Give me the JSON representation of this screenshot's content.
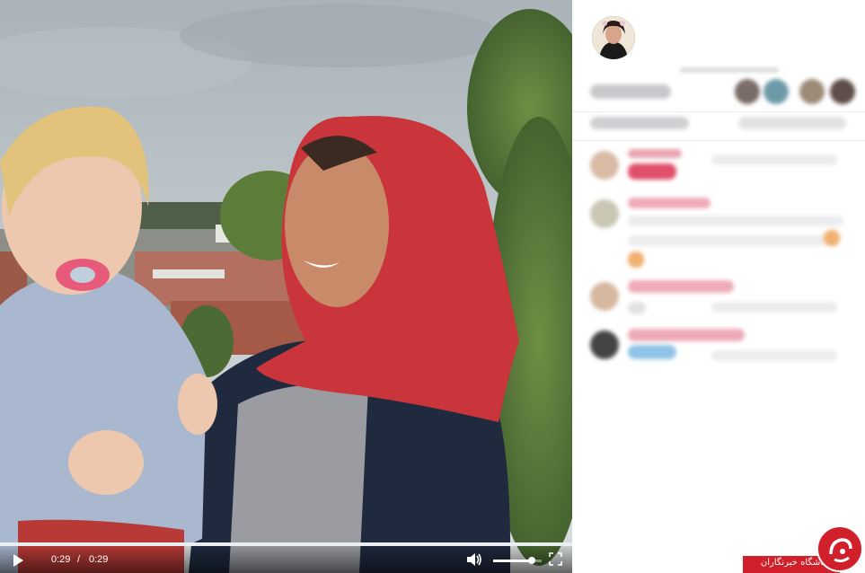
{
  "player": {
    "current_time": "0:29",
    "separator": "/",
    "duration": "0:29",
    "progress": 1.0,
    "volume": 0.8,
    "icons": {
      "play": "play-icon",
      "volume": "volume-icon",
      "fullscreen": "fullscreen-icon"
    }
  },
  "watermark": {
    "text": "باشگاه خبرنگاران"
  },
  "colors": {
    "watermark_red": "#d2202a",
    "scarf_red": "#c9353a",
    "pacifier_pink": "#e85a7a"
  }
}
